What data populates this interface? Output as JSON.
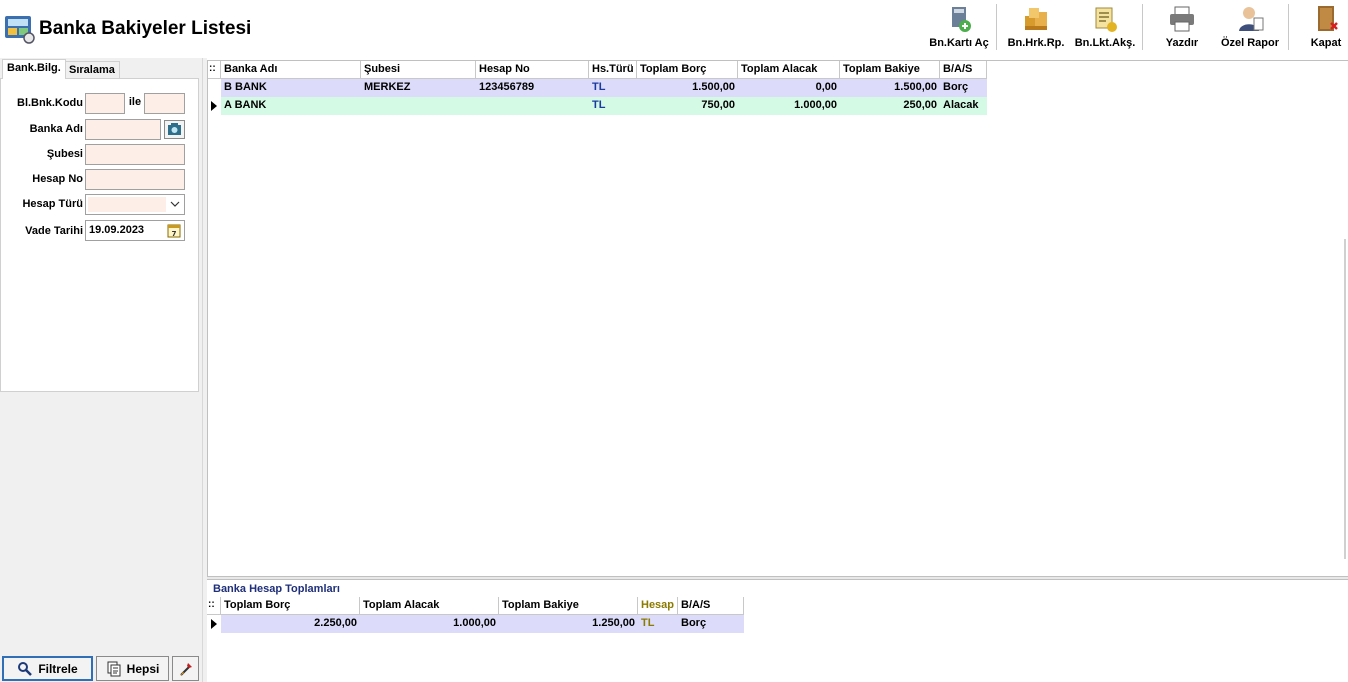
{
  "window": {
    "title": "Banka Bakiyeler Listesi"
  },
  "toolbar": {
    "items": [
      {
        "label": "Bn.Kartı Aç",
        "icon": "bank-card-open-icon"
      },
      {
        "label": "Bn.Hrk.Rp.",
        "icon": "bank-movement-report-icon"
      },
      {
        "label": "Bn.Lkt.Akş.",
        "icon": "bank-liquidity-flow-icon"
      },
      {
        "label": "Yazdır",
        "icon": "printer-icon"
      },
      {
        "label": "Özel Rapor",
        "icon": "custom-report-icon"
      },
      {
        "label": "Kapat",
        "icon": "close-door-icon"
      }
    ]
  },
  "left_panel": {
    "tabs": [
      "Bank.Bilg.",
      "Sıralama"
    ],
    "fields": {
      "code_label": "Bl.Bnk.Kodu",
      "code_from": "",
      "code_between": "ile",
      "code_to": "",
      "bank_name_label": "Banka Adı",
      "bank_name": "",
      "branch_label": "Şubesi",
      "branch": "",
      "account_no_label": "Hesap No",
      "account_no": "",
      "account_type_label": "Hesap Türü",
      "account_type": "",
      "due_date_label": "Vade Tarihi",
      "due_date": "19.09.2023"
    },
    "buttons": {
      "filter": "Filtrele",
      "all": "Hepsi"
    }
  },
  "grid": {
    "indicator_header": "::",
    "columns": [
      "Banka Adı",
      "Şubesi",
      "Hesap No",
      "Hs.Türü",
      "Toplam Borç",
      "Toplam Alacak",
      "Toplam Bakiye",
      "B/A/S"
    ],
    "rows": [
      {
        "bank": "B BANK",
        "branch": "MERKEZ",
        "account_no": "123456789",
        "type": "TL",
        "debit": "1.500,00",
        "credit": "0,00",
        "balance": "1.500,00",
        "bas": "Borç",
        "color": "#dcdcfa"
      },
      {
        "bank": "A BANK",
        "branch": "",
        "account_no": "",
        "type": "TL",
        "debit": "750,00",
        "credit": "1.000,00",
        "balance": "250,00",
        "bas": "Alacak",
        "color": "#d4fae6"
      }
    ]
  },
  "totals": {
    "title": "Banka Hesap Toplamları",
    "indicator_header": "::",
    "columns": [
      "Toplam Borç",
      "Toplam Alacak",
      "Toplam Bakiye",
      "Hesap",
      "B/A/S"
    ],
    "row": {
      "debit": "2.250,00",
      "credit": "1.000,00",
      "balance": "1.250,00",
      "account": "TL",
      "bas": "Borç",
      "color": "#dcdcfa"
    },
    "hesap_color": "#8a7a00"
  }
}
